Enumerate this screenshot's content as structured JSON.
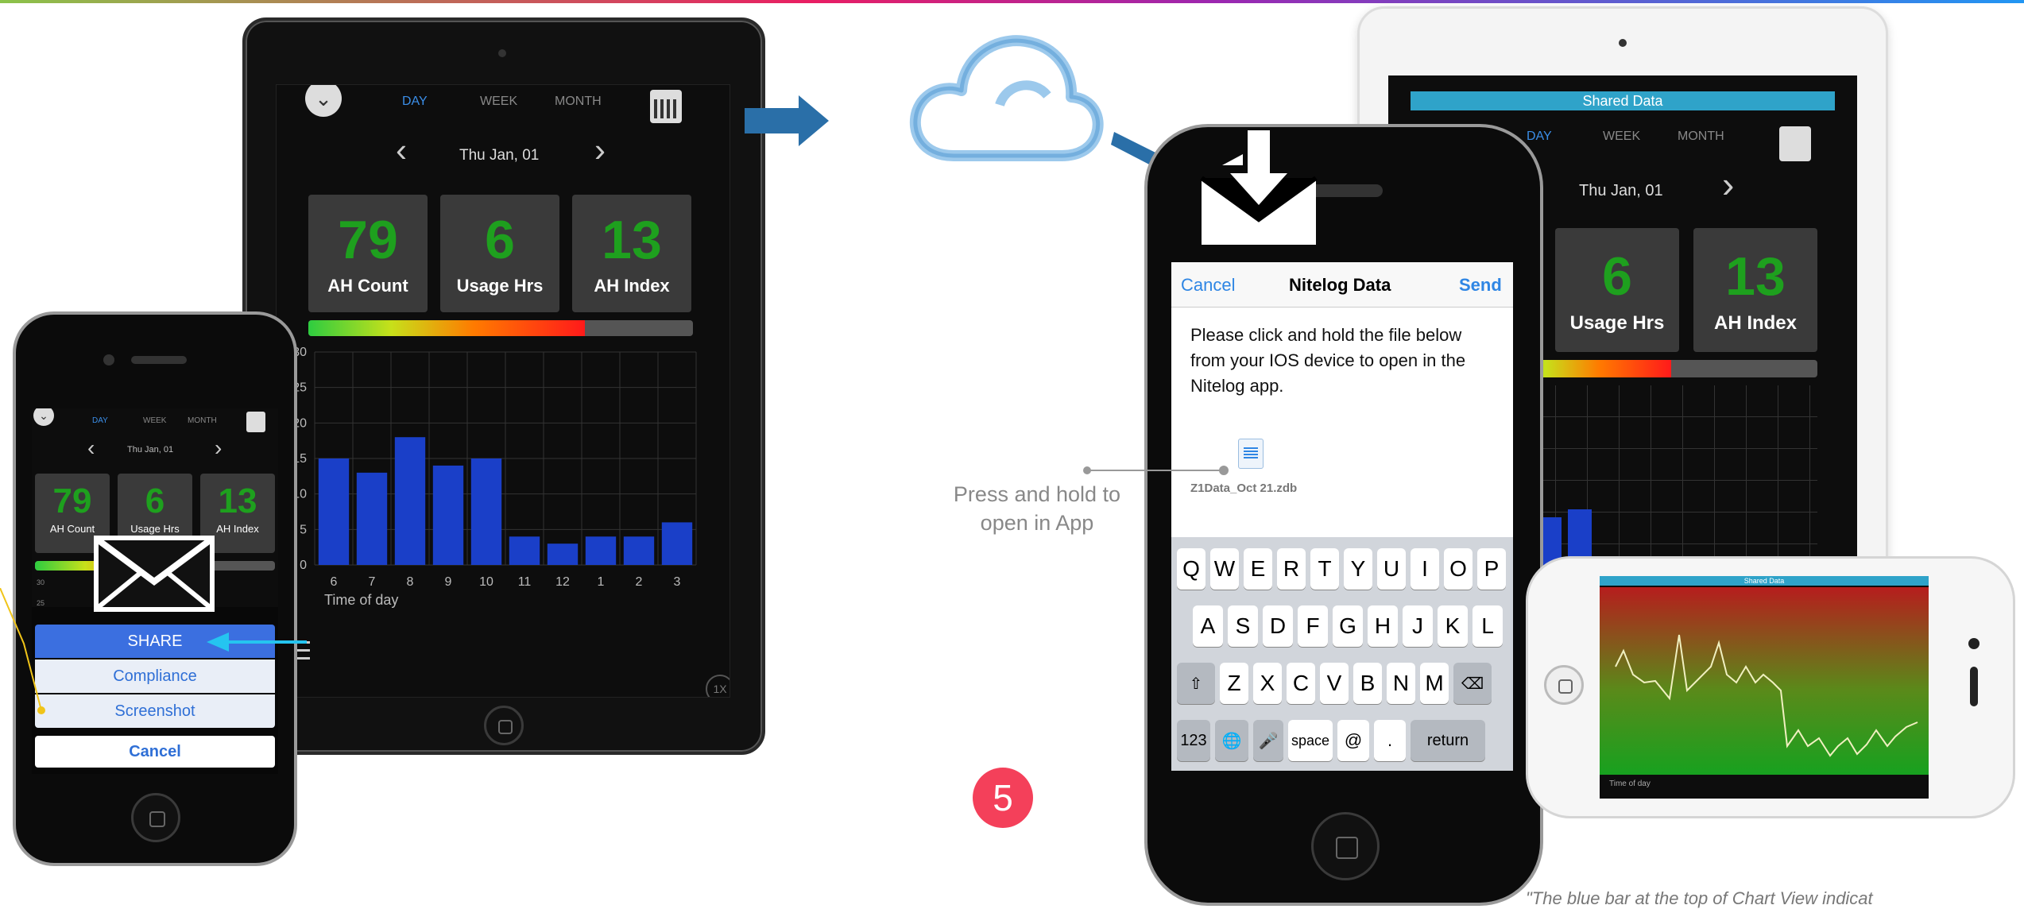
{
  "colors": {
    "accent_blue": "#3b8ee8",
    "green_value": "#1ea01e",
    "bar_blue": "#1a3fc8",
    "badge_red": "#f4405a"
  },
  "ipad_left": {
    "tabs": [
      "DAY",
      "WEEK",
      "MONTH"
    ],
    "active_tab": "DAY",
    "date": "Thu Jan, 01",
    "stats": [
      {
        "value": "79",
        "label": "AH Count"
      },
      {
        "value": "6",
        "label": "Usage Hrs"
      },
      {
        "value": "13",
        "label": "AH Index"
      }
    ],
    "meter_fraction": 0.72,
    "xlabel": "Time of day",
    "zoom": "1X"
  },
  "chart_data": {
    "type": "bar",
    "categories": [
      "6",
      "7",
      "8",
      "9",
      "10",
      "11",
      "12",
      "1",
      "2",
      "3"
    ],
    "values": [
      15,
      13,
      18,
      14,
      15,
      4,
      3,
      4,
      4,
      6
    ],
    "xlabel": "Time of day",
    "ylabel": "",
    "ylim": [
      0,
      30
    ],
    "yticks": [
      0,
      5,
      10,
      15,
      20,
      25,
      30
    ],
    "grid": true
  },
  "phone_left": {
    "tabs": [
      "DAY",
      "WEEK",
      "MONTH"
    ],
    "date": "Thu Jan, 01",
    "stats": [
      {
        "value": "79",
        "label": "AH Count"
      },
      {
        "value": "6",
        "label": "Usage Hrs"
      },
      {
        "value": "13",
        "label": "AH Index"
      }
    ],
    "menu": {
      "share": "SHARE",
      "compliance": "Compliance",
      "screenshot": "Screenshot",
      "cancel": "Cancel"
    },
    "mini_ticks": [
      "30",
      "25"
    ]
  },
  "email": {
    "cancel": "Cancel",
    "title": "Nitelog Data",
    "send": "Send",
    "body": "Please click and hold the file below from your IOS device to open in the Nitelog app.",
    "attachment_name": "Z1Data_Oct 21.zdb"
  },
  "keyboard": {
    "row1": [
      "Q",
      "W",
      "E",
      "R",
      "T",
      "Y",
      "U",
      "I",
      "O",
      "P"
    ],
    "row2": [
      "A",
      "S",
      "D",
      "F",
      "G",
      "H",
      "J",
      "K",
      "L"
    ],
    "row3": [
      "Z",
      "X",
      "C",
      "V",
      "B",
      "N",
      "M"
    ],
    "num_key": "123",
    "space": "space",
    "at": "@",
    "dot": ".",
    "return": "return"
  },
  "annotation": "Press and hold to open in App",
  "step_badge": "5",
  "ipad_right": {
    "banner": "Shared Data",
    "tabs": [
      "DAY",
      "WEEK",
      "MONTH"
    ],
    "date": "Thu Jan, 01",
    "stats": [
      {
        "value": "6",
        "label": "Usage Hrs"
      },
      {
        "value": "13",
        "label": "AH Index"
      }
    ]
  },
  "phone_landscape": {
    "banner": "Shared Data",
    "xlabel": "Time of day"
  },
  "footer_text": "\"The blue bar at the top of Chart View indicat"
}
